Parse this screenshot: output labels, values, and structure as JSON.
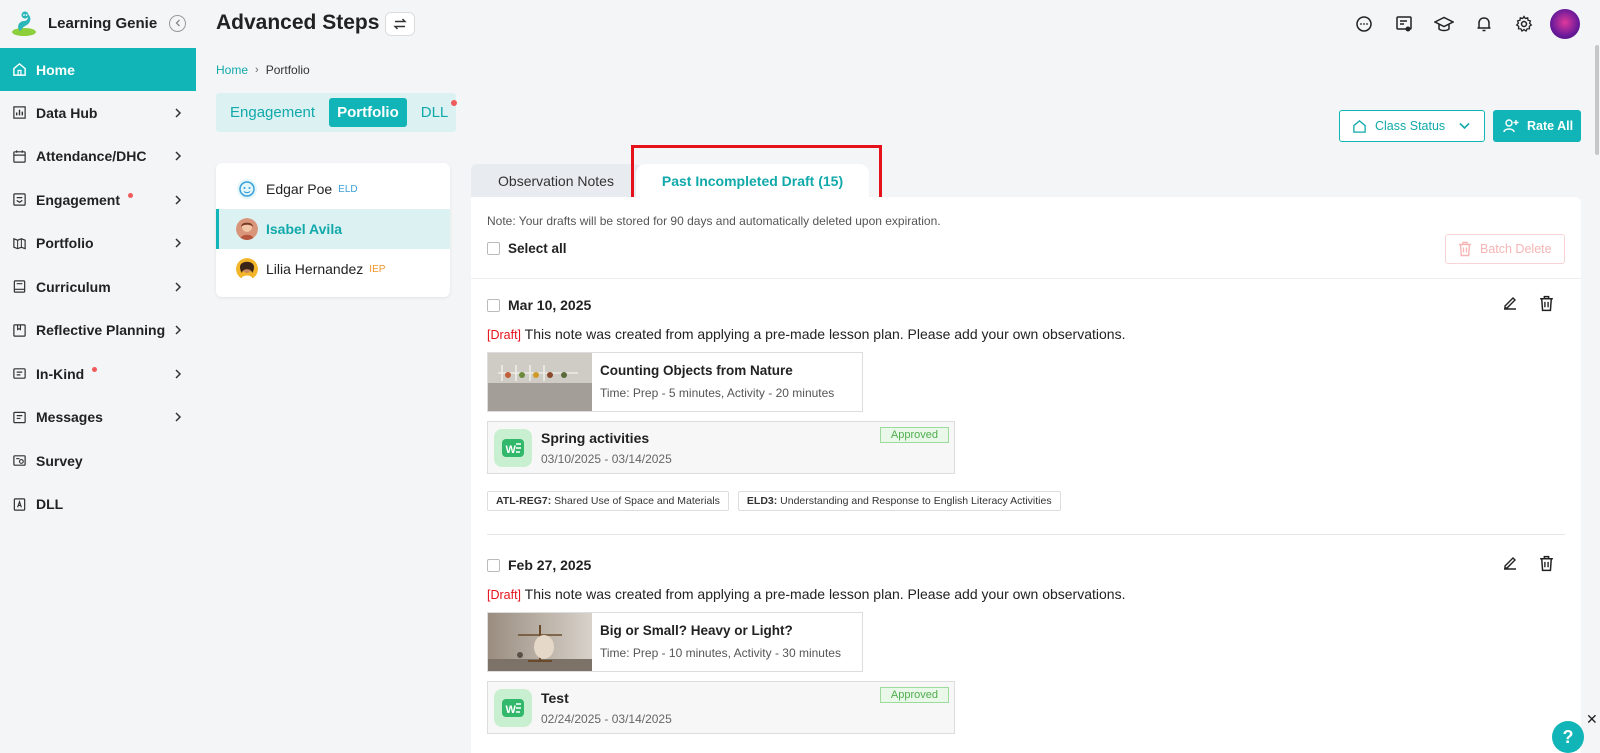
{
  "brand": {
    "name": "Learning Genie"
  },
  "nav": [
    {
      "label": "Home",
      "icon": "home-icon",
      "active": true,
      "dot": false,
      "chevron": false
    },
    {
      "label": "Data Hub",
      "icon": "chart-icon",
      "dot": false,
      "chevron": true
    },
    {
      "label": "Attendance/DHC",
      "icon": "calendar-icon",
      "dot": false,
      "chevron": true
    },
    {
      "label": "Engagement",
      "icon": "engagement-icon",
      "dot": true,
      "chevron": true
    },
    {
      "label": "Portfolio",
      "icon": "portfolio-icon",
      "dot": false,
      "chevron": true
    },
    {
      "label": "Curriculum",
      "icon": "book-icon",
      "dot": false,
      "chevron": true
    },
    {
      "label": "Reflective Planning",
      "icon": "planning-icon",
      "dot": false,
      "chevron": true
    },
    {
      "label": "In-Kind",
      "icon": "inkind-icon",
      "dot": true,
      "chevron": true
    },
    {
      "label": "Messages",
      "icon": "message-icon",
      "dot": false,
      "chevron": true
    },
    {
      "label": "Survey",
      "icon": "survey-icon",
      "dot": false,
      "chevron": false
    },
    {
      "label": "DLL",
      "icon": "dll-icon",
      "dot": false,
      "chevron": false
    }
  ],
  "header": {
    "title": "Advanced Steps"
  },
  "breadcrumb": {
    "home": "Home",
    "current": "Portfolio"
  },
  "top_tabs": {
    "engagement": "Engagement",
    "portfolio": "Portfolio",
    "dll": "DLL"
  },
  "actions": {
    "class_status": "Class Status",
    "rate_all": "Rate All"
  },
  "children": [
    {
      "name": "Edgar Poe",
      "tag": "ELD",
      "tag_type": "eld"
    },
    {
      "name": "Isabel Avila",
      "tag": "",
      "tag_type": "",
      "active": true
    },
    {
      "name": "Lilia Hernandez",
      "tag": "IEP",
      "tag_type": "iep"
    }
  ],
  "content_tabs": {
    "observation": "Observation Notes",
    "past_draft": "Past Incompleted Draft (15)"
  },
  "panel": {
    "note": "Note: Your drafts will be stored for 90 days and automatically deleted upon expiration.",
    "select_all": "Select all",
    "batch_delete": "Batch Delete"
  },
  "entries": [
    {
      "date": "Mar 10, 2025",
      "draft_tag": "[Draft]",
      "draft_text": " This note was created from applying a pre-made lesson plan. Please add your own observations.",
      "lesson_title": "Counting Objects from Nature",
      "lesson_time": "Time: Prep - 5 minutes, Activity - 20 minutes",
      "plan_title": "Spring activities",
      "plan_dates": "03/10/2025 - 03/14/2025",
      "plan_status": "Approved",
      "tags": [
        {
          "code": "ATL-REG7:",
          "text": " Shared Use of Space and Materials"
        },
        {
          "code": "ELD3:",
          "text": " Understanding and Response to English Literacy Activities"
        }
      ]
    },
    {
      "date": "Feb 27, 2025",
      "draft_tag": "[Draft]",
      "draft_text": " This note was created from applying a pre-made lesson plan. Please add your own observations.",
      "lesson_title": "Big or Small? Heavy or Light?",
      "lesson_time": "Time: Prep - 10 minutes, Activity - 30 minutes",
      "plan_title": "Test",
      "plan_dates": "02/24/2025 - 03/14/2025",
      "plan_status": "Approved"
    }
  ],
  "help": {
    "label": "?"
  },
  "colors": {
    "accent": "#12b5b7",
    "danger": "#e5121b",
    "dot": "#f05a5a"
  }
}
